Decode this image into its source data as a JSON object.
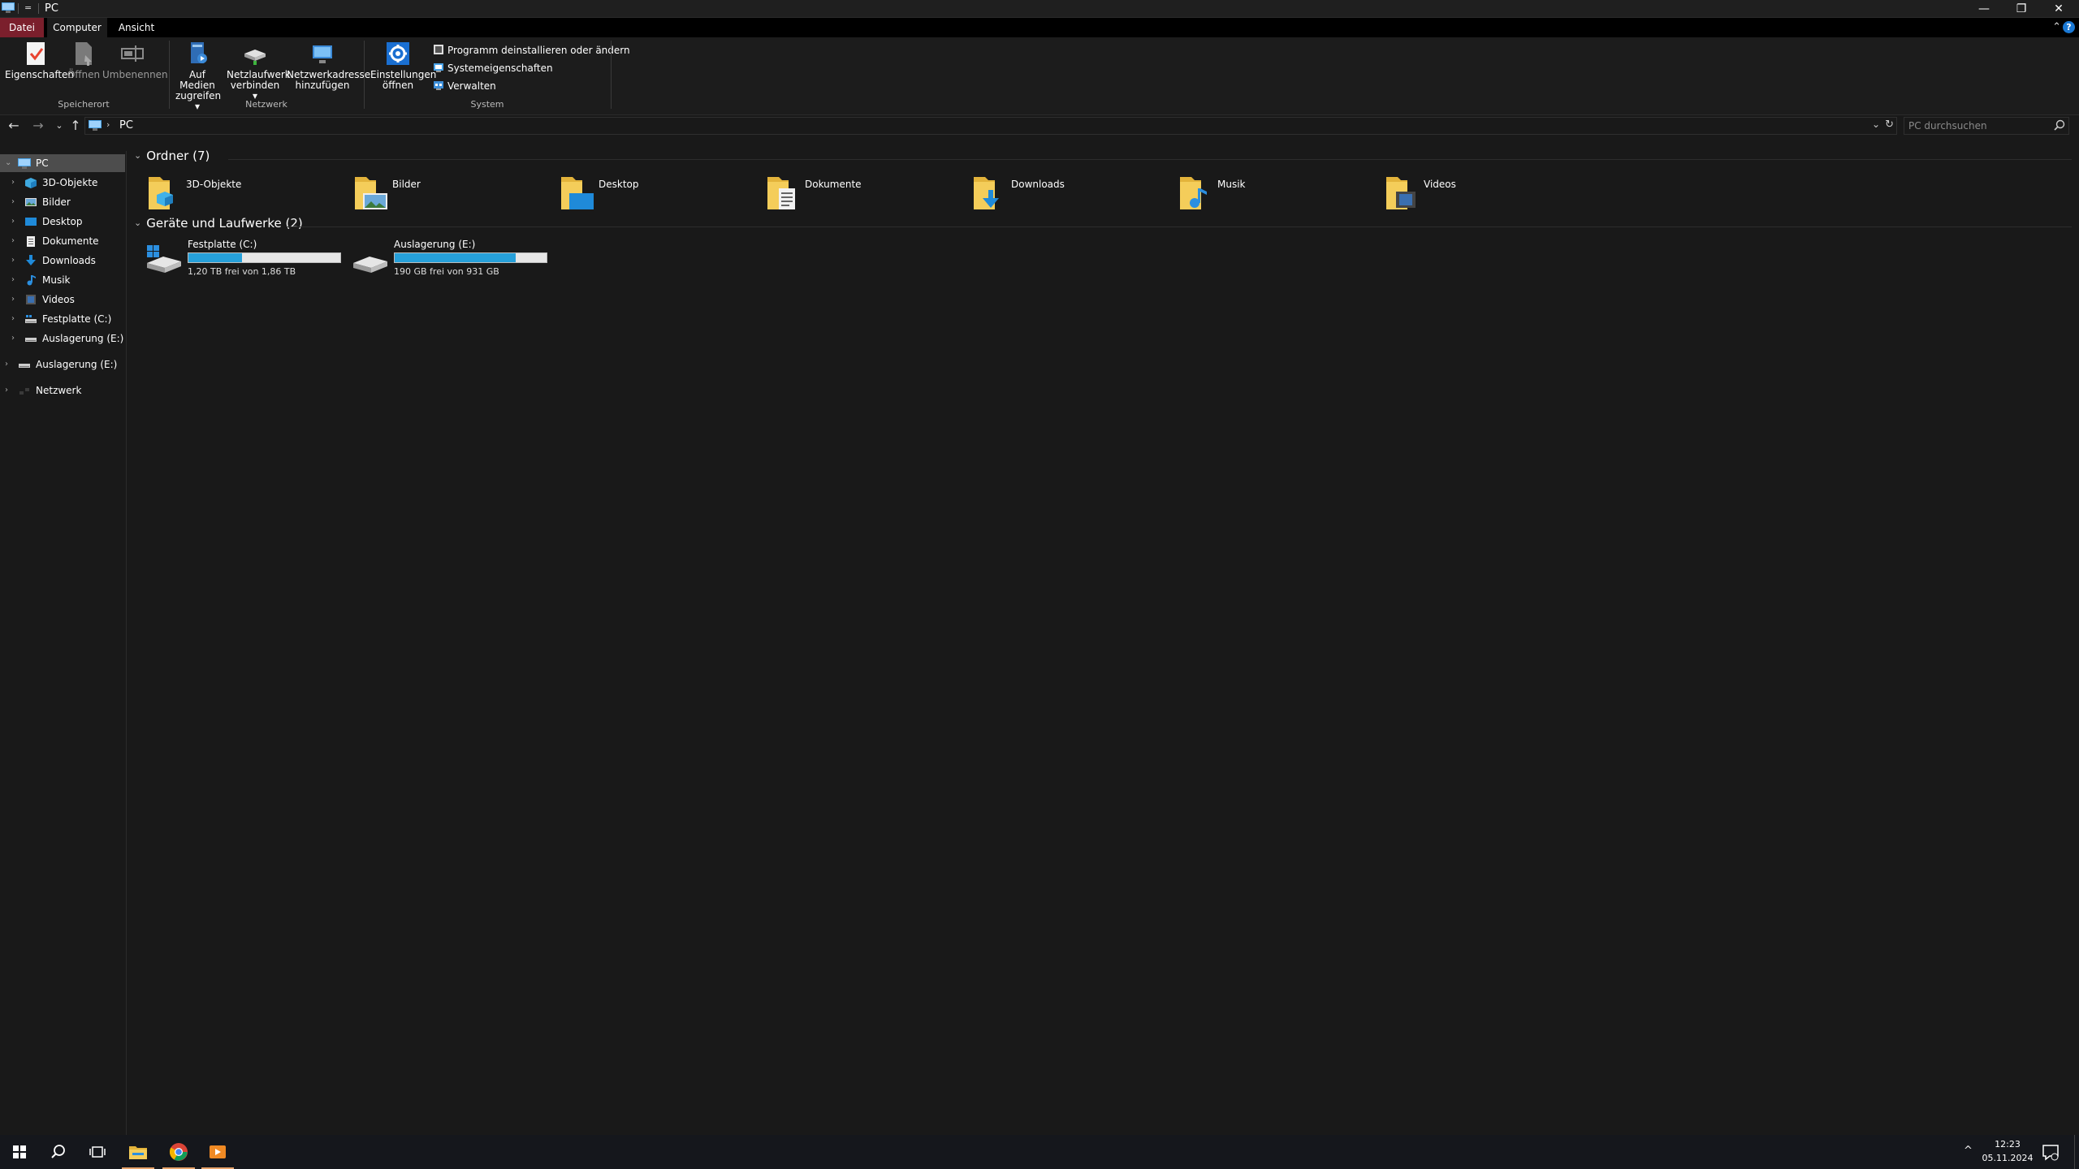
{
  "window": {
    "title": "PC",
    "quick_access_arrow": "=",
    "controls": {
      "minimize": "—",
      "maximize": "❐",
      "close": "✕"
    }
  },
  "ribbon_tabs": [
    {
      "label": "Datei"
    },
    {
      "label": "Computer"
    },
    {
      "label": "Ansicht"
    }
  ],
  "ribbon": {
    "speicherort": {
      "label": "Speicherort",
      "eigenschaften": "Eigenschaften",
      "oeffnen": "Öffnen",
      "umbenennen": "Umbenennen"
    },
    "netzwerk": {
      "label": "Netzwerk",
      "medien": "Auf Medien zugreifen ▾",
      "netzlaufwerk": "Netzlaufwerk verbinden ▾",
      "netzwerkadresse": "Netzwerkadresse hinzufügen"
    },
    "system": {
      "label": "System",
      "einstellungen": "Einstellungen öffnen",
      "programm": "Programm deinstallieren oder ändern",
      "systemeigenschaften": "Systemeigenschaften",
      "verwalten": "Verwalten"
    }
  },
  "address": {
    "breadcrumb": "PC",
    "search_placeholder": "PC durchsuchen"
  },
  "nav_tree": [
    {
      "label": "PC",
      "selected": true
    },
    {
      "label": "3D-Objekte"
    },
    {
      "label": "Bilder"
    },
    {
      "label": "Desktop"
    },
    {
      "label": "Dokumente"
    },
    {
      "label": "Downloads"
    },
    {
      "label": "Musik"
    },
    {
      "label": "Videos"
    },
    {
      "label": "Festplatte (C:)"
    },
    {
      "label": "Auslagerung (E:)"
    },
    {
      "label": "Auslagerung (E:)"
    },
    {
      "label": "Netzwerk"
    }
  ],
  "groups": {
    "folders_header": "Ordner (7)",
    "drives_header": "Geräte und Laufwerke (2)"
  },
  "folders": [
    {
      "name": "3D-Objekte",
      "icon": "3d-objects-folder-icon"
    },
    {
      "name": "Bilder",
      "icon": "pictures-folder-icon"
    },
    {
      "name": "Desktop",
      "icon": "desktop-folder-icon"
    },
    {
      "name": "Dokumente",
      "icon": "documents-folder-icon"
    },
    {
      "name": "Downloads",
      "icon": "downloads-folder-icon"
    },
    {
      "name": "Musik",
      "icon": "music-folder-icon"
    },
    {
      "name": "Videos",
      "icon": "videos-folder-icon"
    }
  ],
  "drives": [
    {
      "name": "Festplatte (C:)",
      "free_text": "1,20 TB frei von 1,86 TB",
      "used_fraction": 0.355
    },
    {
      "name": "Auslagerung (E:)",
      "free_text": "190 GB frei von 931 GB",
      "used_fraction": 0.796
    }
  ],
  "taskbar": {
    "time": "12:23",
    "date": "05.11.2024",
    "tray_arrow": "^"
  },
  "colors": {
    "file_tab": "#7b1f2c",
    "drive_bar_fill": "#26a0da",
    "folder_yellow": "#f0c14b",
    "taskbar_active_underline": "#e7a36b"
  }
}
